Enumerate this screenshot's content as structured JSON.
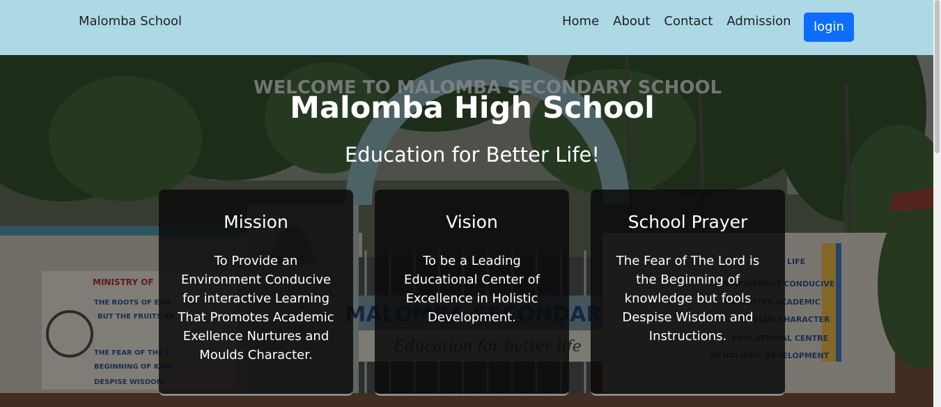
{
  "navbar": {
    "brand": "Malomba School",
    "links": [
      "Home",
      "About",
      "Contact",
      "Admission"
    ],
    "login_label": "login",
    "background": "#add8e6",
    "login_color": "#0d6efd"
  },
  "hero": {
    "title": "Malomba High School",
    "subtitle": "Education for Better Life!",
    "cards": [
      {
        "title": "Mission",
        "text": "To Provide an Environment Conducive for interactive Learning That Promotes Academic Exellence Nurtures and Moulds Character."
      },
      {
        "title": "Vision",
        "text": "To be a Leading Educational Center of Excellence in Holistic Development."
      },
      {
        "title": "School Prayer",
        "text": "The Fear of The Lord is the Beginning of knowledge but fools Despise Wisdom and Instructions."
      }
    ]
  },
  "background_image": {
    "gate_sign": "WELCOME TO MALOMBA SECONDARY SCHOOL",
    "wall_text": [
      "MINISTRY OF",
      "THE ROOTS OF EDU",
      "BUT THE FRUITS AR",
      "THE FEAR OF THE L",
      "BEGINNING OF KNO",
      "DESPISE WISDOM",
      "LIFE",
      "ENVIRONMENT CONDUCIVE",
      "PROMOTES ACADEMIC",
      "MOULDS CHARACTER",
      "EDUCATIONAL CENTRE",
      "IN HOLISTIC DEVELOPMENT",
      "MALOMBA SECONDARY",
      "Education for better life",
      "MALOMBA SECONDARY SCHOOL"
    ]
  }
}
